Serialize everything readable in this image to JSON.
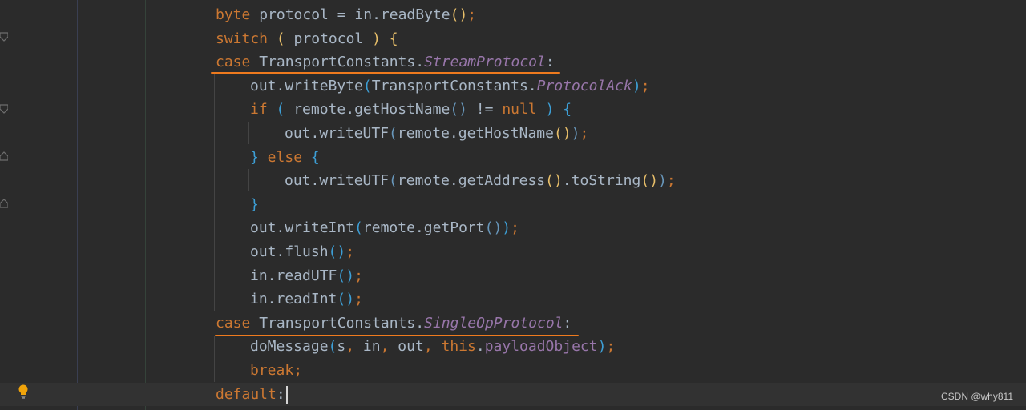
{
  "colors": {
    "background": "#2b2b2b",
    "keyword": "#cc7832",
    "text": "#a9b7c6",
    "field": "#9876aa",
    "highlight_underline": "#ee7a1e"
  },
  "code": {
    "l1": {
      "kw": "byte",
      "rest": " protocol = in.readByte",
      "open": "(",
      "close": ")",
      "end": ";"
    },
    "l2": {
      "kw": "switch",
      "a": " ",
      "open": "(",
      "mid": " protocol ",
      "close": ")",
      "b": " ",
      "brace": "{"
    },
    "l3": {
      "kw": "case",
      "cls": " TransportConstants.",
      "fld": "StreamProtocol",
      "colon": ":"
    },
    "l4": {
      "a": "out.writeByte",
      "open": "(",
      "cls": "TransportConstants.",
      "fld": "ProtocolAck",
      "close": ")",
      "end": ";"
    },
    "l5": {
      "kw": "if",
      "a": " ",
      "open": "(",
      "mid": " remote.getHostName",
      "op": "()",
      "neq": " != ",
      "null": "null",
      "b": " ",
      "close": ")",
      "c": " ",
      "brace": "{"
    },
    "l6": {
      "a": "out.writeUTF",
      "open": "(",
      "mid": "remote.getHostName",
      "inner": "()",
      "close": ")",
      "end": ";"
    },
    "l7": {
      "brace1": "}",
      "kw": " else ",
      "brace2": "{"
    },
    "l8": {
      "a": "out.writeUTF",
      "open": "(",
      "mid": "remote.getAddress",
      "inner1": "()",
      "dot": ".toString",
      "inner2": "()",
      "close": ")",
      "end": ";"
    },
    "l9": {
      "brace": "}"
    },
    "l10": {
      "a": "out.writeInt",
      "open": "(",
      "mid": "remote.getPort",
      "inner": "()",
      "close": ")",
      "end": ";"
    },
    "l11": {
      "a": "out.flush",
      "paren": "()",
      "end": ";"
    },
    "l12": {
      "a": "in.readUTF",
      "paren": "()",
      "end": ";"
    },
    "l13": {
      "a": "in.readInt",
      "paren": "()",
      "end": ";"
    },
    "l14": {
      "kw": "case",
      "cls": " TransportConstants.",
      "fld": "SingleOpProtocol",
      "colon": ":"
    },
    "l15": {
      "a": "doMessage",
      "open": "(",
      "s": "s",
      "c1": ", ",
      "in": "in",
      "c2": ", ",
      "out": "out",
      "c3": ", ",
      "this": "this",
      "dot": ".",
      "fld": "payloadObject",
      "close": ")",
      "end": ";"
    },
    "l16": {
      "kw": "break",
      "end": ";"
    },
    "l17": {
      "kw": "default",
      "colon": ":"
    }
  },
  "watermark": "CSDN @why811"
}
